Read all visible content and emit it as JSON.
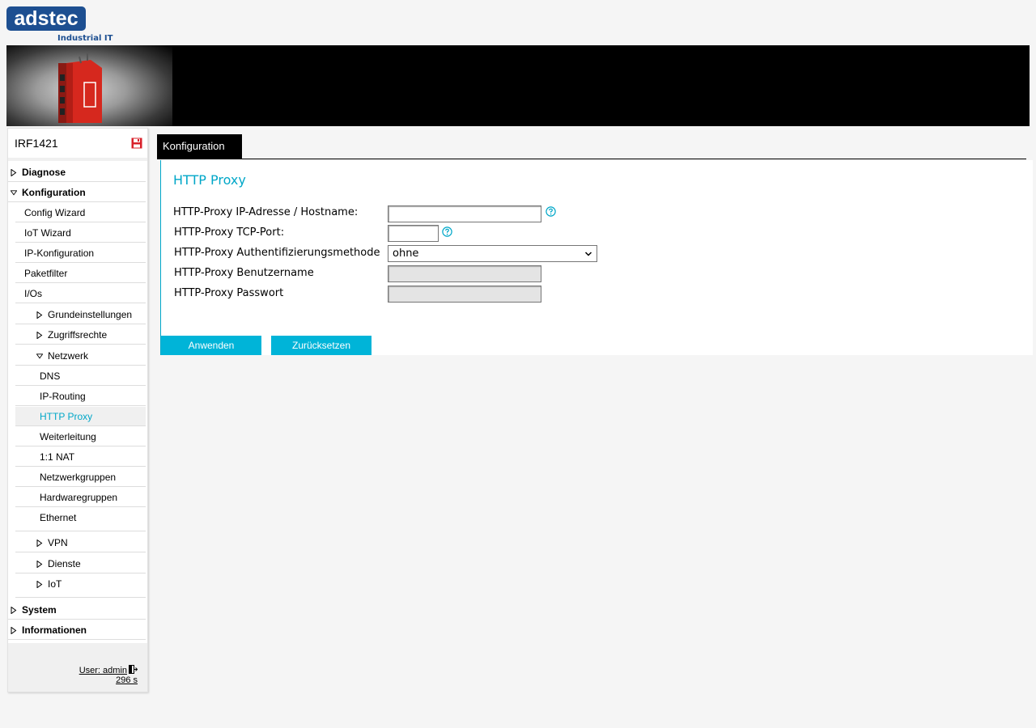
{
  "brand": {
    "logo_text": "adstec",
    "tagline": "Industrial IT"
  },
  "device": {
    "name": "IRF1421"
  },
  "nav": {
    "diagnose": "Diagnose",
    "konfiguration": "Konfiguration",
    "config_wizard": "Config Wizard",
    "iot_wizard": "IoT Wizard",
    "ip_konfiguration": "IP-Konfiguration",
    "paketfilter": "Paketfilter",
    "ios": "I/Os",
    "grundeinstellungen": "Grundeinstellungen",
    "zugriffsrechte": "Zugriffsrechte",
    "netzwerk": "Netzwerk",
    "dns": "DNS",
    "ip_routing": "IP-Routing",
    "http_proxy": "HTTP Proxy",
    "weiterleitung": "Weiterleitung",
    "nat": "1:1 NAT",
    "netzwerkgruppen": "Netzwerkgruppen",
    "hardwaregruppen": "Hardwaregruppen",
    "ethernet": "Ethernet",
    "vpn": "VPN",
    "dienste": "Dienste",
    "iot": "IoT",
    "system": "System",
    "informationen": "Informationen"
  },
  "session": {
    "user": "User: admin",
    "timer": "296 s"
  },
  "tabs": {
    "active": "Konfiguration"
  },
  "form": {
    "title": "HTTP Proxy",
    "host_label": "HTTP-Proxy IP-Adresse / Hostname:",
    "host_value": "",
    "port_label": "HTTP-Proxy TCP-Port:",
    "port_value": "",
    "auth_label": "HTTP-Proxy Authentifizierungsmethode",
    "auth_value": "ohne",
    "user_label": "HTTP-Proxy Benutzername",
    "user_value": "",
    "pass_label": "HTTP-Proxy Passwort",
    "pass_value": "",
    "apply_button": "Anwenden",
    "reset_button": "Zurücksetzen"
  },
  "colors": {
    "accent": "#00a7c8",
    "button": "#00b4d8",
    "brand_blue": "#1d4f91",
    "save_red": "#d8202a"
  }
}
